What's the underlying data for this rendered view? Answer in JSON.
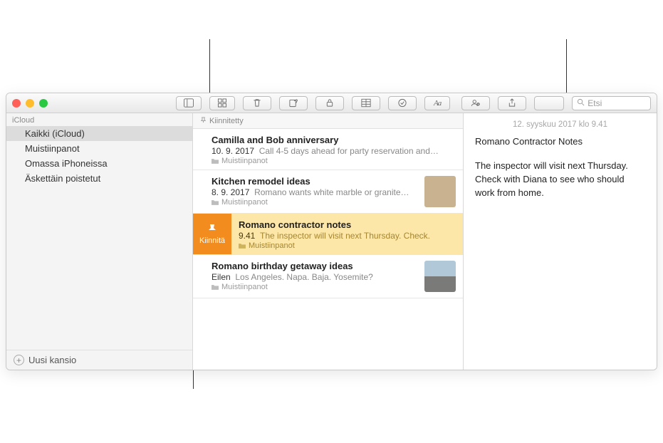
{
  "toolbar": {
    "search_placeholder": "Etsi"
  },
  "sidebar": {
    "header": "iCloud",
    "items": [
      {
        "label": "Kaikki (iCloud)"
      },
      {
        "label": "Muistiinpanot"
      },
      {
        "label": "Omassa iPhoneissa"
      },
      {
        "label": "Äskettäin poistetut"
      }
    ],
    "new_folder": "Uusi kansio"
  },
  "notes_list": {
    "pinned_header": "Kiinnitetty",
    "pin_label": "Kiinnitä",
    "items": [
      {
        "title": "Camilla and Bob anniversary",
        "date": "10. 9. 2017",
        "preview": "Call 4-5 days ahead for party reservation and…",
        "folder": "Muistiinpanot"
      },
      {
        "title": "Kitchen remodel ideas",
        "date": "8. 9. 2017",
        "preview": "Romano wants white marble or granite…",
        "folder": "Muistiinpanot"
      },
      {
        "title": "Romano contractor notes",
        "date": "9.41",
        "preview": "The inspector will visit next Thursday. Check.",
        "folder": "Muistiinpanot"
      },
      {
        "title": "Romano birthday getaway ideas",
        "date": "Eilen",
        "preview": "Los Angeles. Napa. Baja. Yosemite?",
        "folder": "Muistiinpanot"
      }
    ]
  },
  "detail": {
    "date": "12. syyskuu 2017 klo 9.41",
    "title": "Romano Contractor Notes",
    "body": "The inspector will visit next Thursday. Check with Diana to see who should work from home."
  }
}
